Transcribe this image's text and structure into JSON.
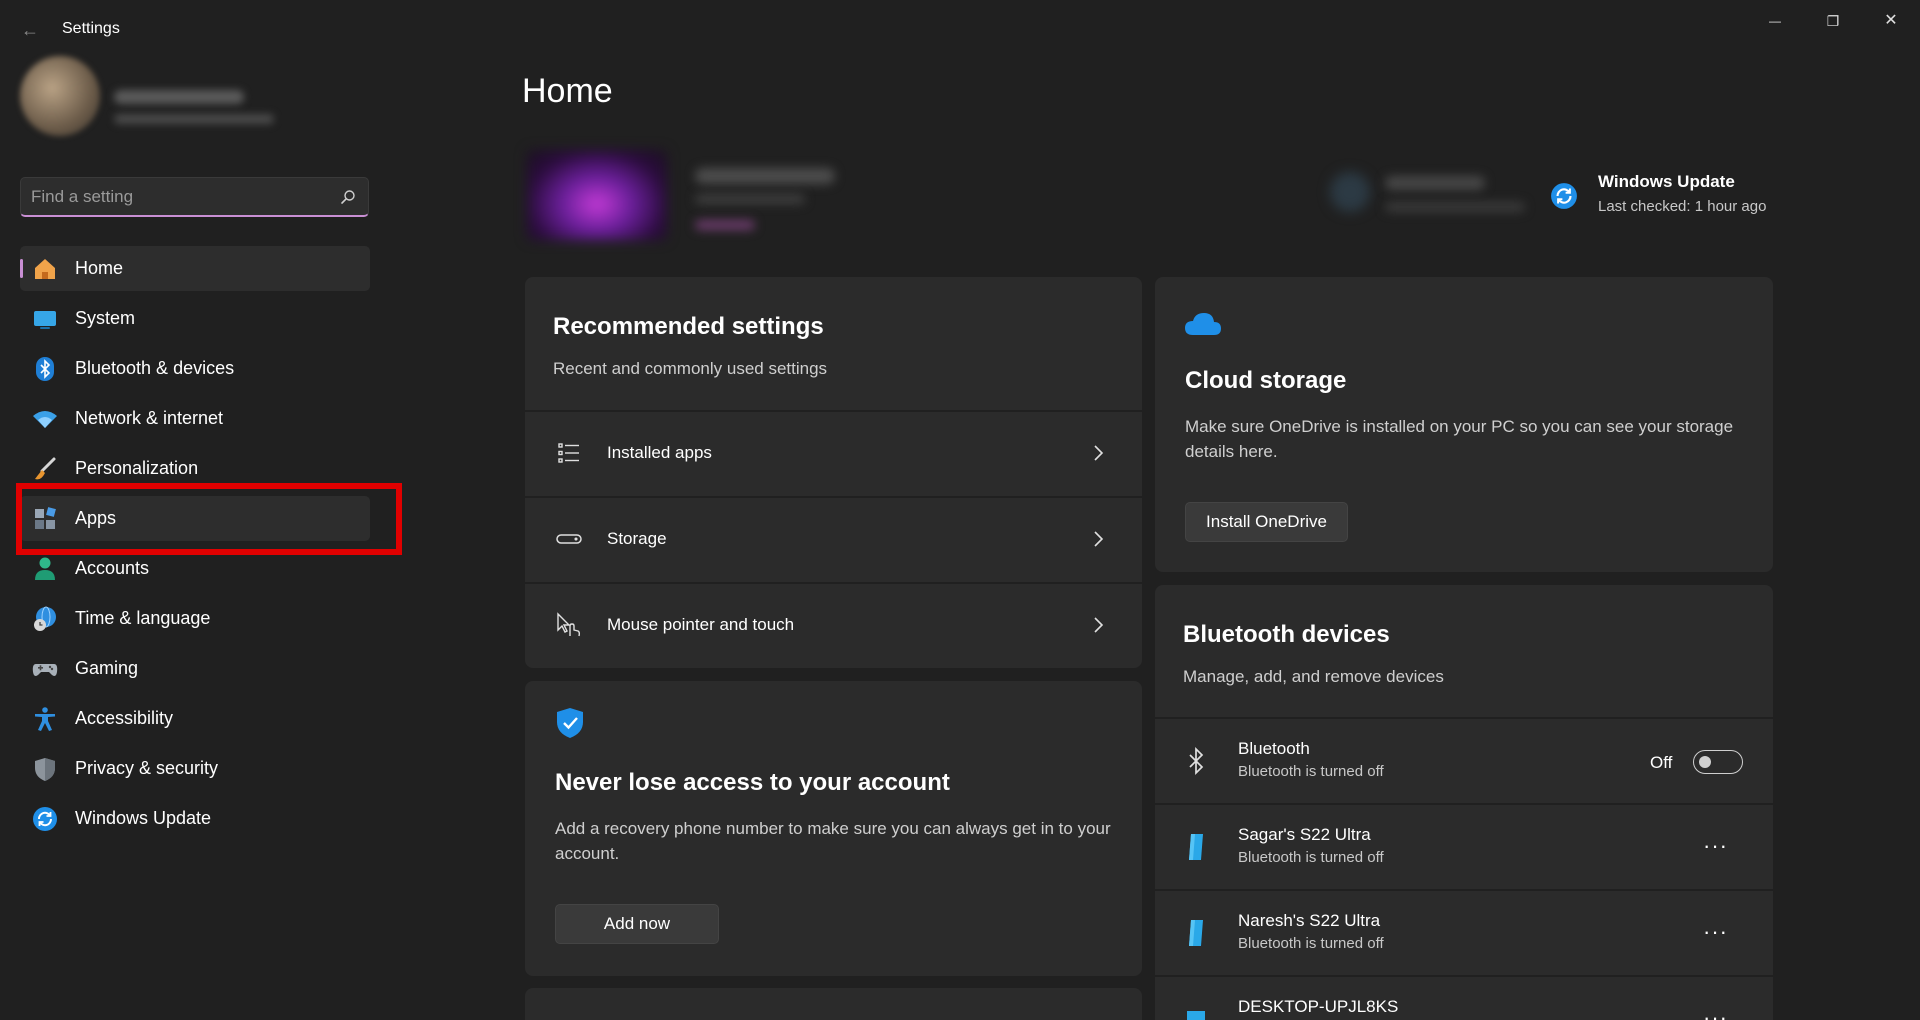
{
  "window": {
    "title": "Settings",
    "back_glyph": "←",
    "minimize_glyph": "—",
    "restore_glyph": "❐",
    "close_glyph": "✕"
  },
  "search": {
    "placeholder": "Find a setting"
  },
  "nav": {
    "items": [
      {
        "label": "Home",
        "icon": "home-icon"
      },
      {
        "label": "System",
        "icon": "system-icon"
      },
      {
        "label": "Bluetooth & devices",
        "icon": "bluetooth-icon"
      },
      {
        "label": "Network & internet",
        "icon": "wifi-icon"
      },
      {
        "label": "Personalization",
        "icon": "brush-icon"
      },
      {
        "label": "Apps",
        "icon": "apps-icon"
      },
      {
        "label": "Accounts",
        "icon": "accounts-icon"
      },
      {
        "label": "Time & language",
        "icon": "globe-clock-icon"
      },
      {
        "label": "Gaming",
        "icon": "gamepad-icon"
      },
      {
        "label": "Accessibility",
        "icon": "accessibility-icon"
      },
      {
        "label": "Privacy & security",
        "icon": "shield-icon"
      },
      {
        "label": "Windows Update",
        "icon": "update-icon"
      }
    ]
  },
  "main": {
    "title": "Home",
    "windows_update": {
      "title": "Windows Update",
      "subtitle": "Last checked: 1 hour ago"
    },
    "recommended": {
      "title": "Recommended settings",
      "subtitle": "Recent and commonly used settings",
      "rows": [
        {
          "label": "Installed apps",
          "icon": "list-icon"
        },
        {
          "label": "Storage",
          "icon": "storage-icon"
        },
        {
          "label": "Mouse pointer and touch",
          "icon": "pointer-touch-icon"
        }
      ]
    },
    "account": {
      "title": "Never lose access to your account",
      "body": "Add a recovery phone number to make sure you can always get in to your account.",
      "button": "Add now"
    },
    "cloud": {
      "title": "Cloud storage",
      "body": "Make sure OneDrive is installed on your PC so you can see your storage details here.",
      "button": "Install OneDrive"
    },
    "bluetooth": {
      "title": "Bluetooth devices",
      "subtitle": "Manage, add, and remove devices",
      "toggle": {
        "name": "Bluetooth",
        "status": "Bluetooth is turned off",
        "state": "Off"
      },
      "devices": [
        {
          "name": "Sagar's S22 Ultra",
          "status": "Bluetooth is turned off"
        },
        {
          "name": "Naresh's S22 Ultra",
          "status": "Bluetooth is turned off"
        },
        {
          "name": "DESKTOP-UPJL8KS",
          "status": ""
        }
      ],
      "more_glyph": "···"
    }
  },
  "colors": {
    "background": "#202020",
    "card": "#2b2b2b",
    "accent": "#c98fd4",
    "highlight": "#e00000",
    "link_blue": "#1f8fe8"
  }
}
